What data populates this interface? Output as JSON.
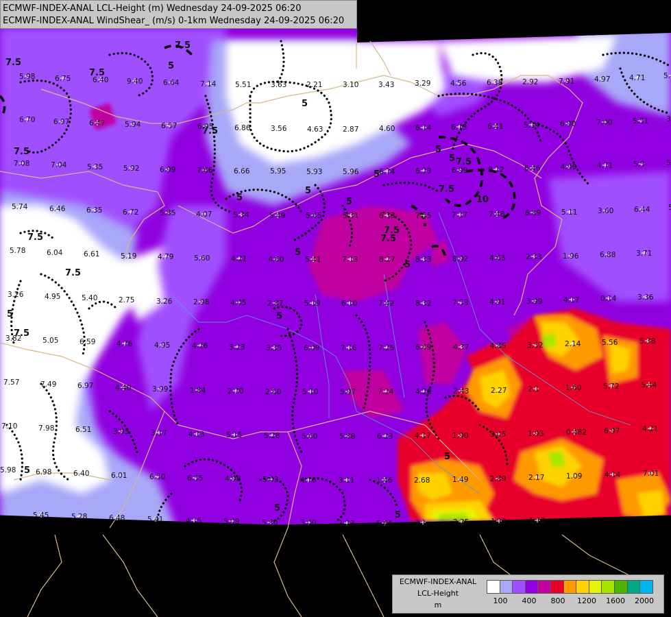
{
  "header": {
    "line1": "ECMWF-INDEX-ANAL LCL-Height (m) Wednesday 24-09-2025 06:20",
    "line2": "ECMWF-INDEX-ANAL WindShear_ (m/s) 0-1km Wednesday 24-09-2025 06:20"
  },
  "legend": {
    "title1": "ECMWF-INDEX-ANAL",
    "title2": "LCL-Height",
    "title3": "m",
    "colors": [
      "#ffffff",
      "#a8a8f8",
      "#a050ff",
      "#9000e0",
      "#c000a0",
      "#e8002a",
      "#ff9900",
      "#ffd200",
      "#e6f500",
      "#a8e600",
      "#4cb400",
      "#00a884",
      "#00b4f0"
    ],
    "ticks": [
      "100",
      "400",
      "800",
      "1200",
      "1600",
      "2000"
    ]
  },
  "map": {
    "contour_labels": [
      "7.5",
      "7.5",
      "7.5",
      "5",
      "7.5",
      "5",
      "7.5",
      "5",
      "5",
      "5",
      "5",
      "5",
      "5",
      "7.5",
      "7.5",
      "7.5",
      "10",
      "7.5",
      "5",
      "5",
      "7.5",
      "5",
      "7.5",
      "7.5",
      "5",
      "5",
      "5",
      "5",
      "5"
    ],
    "point_values": [
      "5.98",
      "6.75",
      "6.40",
      "9.40",
      "6.64",
      "7.14",
      "5.51",
      "3.63",
      "2.21",
      "3.10",
      "3.43",
      "3.29",
      "4.56",
      "6.38",
      "2.92",
      "7.91",
      "4.97",
      "4.71",
      "5.49",
      "6.70",
      "6.97",
      "6.47",
      "5.94",
      "6.57",
      "6.95",
      "6.86",
      "3.56",
      "4.63",
      "2.87",
      "4.60",
      "6.14",
      "6.73",
      "6.41",
      "5.14",
      "6.90",
      "7.00",
      "5.51",
      "3.01",
      "7.08",
      "7.04",
      "5.35",
      "5.92",
      "6.99",
      "7.66",
      "6.66",
      "5.95",
      "5.93",
      "5.96",
      "6.74",
      "6.23",
      "6.99",
      "8.22",
      "6.46",
      "4.90",
      "4.71",
      "5.5",
      "5.75",
      "5.74",
      "6.46",
      "6.35",
      "6.72",
      "5.85",
      "4.07",
      "5.34",
      "5.49",
      "5.65",
      "5.31",
      "6.33",
      "7.55",
      "7.17",
      "7.48",
      "6.89",
      "5.11",
      "3.60",
      "6.44",
      "5.95",
      "5.78",
      "6.04",
      "6.61",
      "5.19",
      "4.79",
      "5.60",
      "4.21",
      "4.60",
      "5.41",
      "7.13",
      "8.27",
      "8.33",
      "8.92",
      "4.63",
      "2.33",
      "1.96",
      "6.88",
      "3.71",
      "3.26",
      "4.95",
      "5.40",
      "2.75",
      "3.26",
      "2.98",
      "4.05",
      "2.87",
      "5.19",
      "6.10",
      "7.42",
      "8.32",
      "7.53",
      "4.91",
      "3.99",
      "4.17",
      "0.14",
      "3.36",
      "3.82",
      "5.05",
      "6.59",
      "4.76",
      "4.95",
      "4.26",
      "3.23",
      "3.35",
      "6.09",
      "7.16",
      "7.25",
      "6.69",
      "4.37",
      "4.85",
      "3.52",
      "2.14",
      "5.56",
      "5.38",
      "7.57",
      "7.49",
      "6.97",
      "4.40",
      "3.99",
      "1.84",
      "2.70",
      "2.60",
      "5.10",
      "5.97",
      "7.24",
      "4.20",
      "2.43",
      "2.27",
      "2.1",
      "1.60",
      "5.72",
      "5.44",
      "7.10",
      "7.98",
      "6.51",
      "3.95",
      "3.17",
      "4.13",
      "5.15",
      "5.28",
      "5.60",
      "5.88",
      "6.23",
      "4.17",
      "1.90",
      "3.05",
      "1.93",
      "0.482",
      "6.97",
      "4.21",
      "5.98",
      "6.98",
      "6.40",
      "6.01",
      "6.50",
      "6.55",
      "4.98",
      "5.03",
      "4.76",
      "3.11",
      "1.46",
      "2.68",
      "1.49",
      "2.89",
      "2.17",
      "1.09",
      "4.14",
      "7.01",
      "5.45",
      "5.28",
      "6.48",
      "5.41",
      "4.15",
      "5.09",
      "5.80",
      "3.00",
      "1.23",
      "5.64",
      "3.1",
      "2.25",
      "1.11",
      "1.13"
    ]
  }
}
